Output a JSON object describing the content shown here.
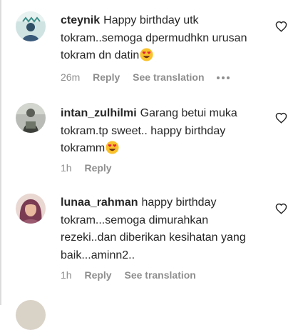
{
  "comments": [
    {
      "username": "cteynik",
      "text": "Happy birthday utk tokram..semoga dpermudhkn urusan tokram dn datin",
      "emoji": "heart-eyes-emoji",
      "time": "26m",
      "reply": "Reply",
      "translation": "See translation",
      "has_more": true
    },
    {
      "username": "intan_zulhilmi",
      "text": "Garang betui muka tokram.tp sweet.. happy birthday tokramm",
      "emoji": "heart-eyes-emoji",
      "time": "1h",
      "reply": "Reply"
    },
    {
      "username": "lunaa_rahman",
      "text": "happy birthday tokram...semoga dimurahkan rezeki..dan diberikan kesihatan yang baik...aminn2..",
      "time": "1h",
      "reply": "Reply",
      "translation": "See translation"
    }
  ],
  "colors": {
    "text": "#262626",
    "muted": "#8e8e8e"
  }
}
